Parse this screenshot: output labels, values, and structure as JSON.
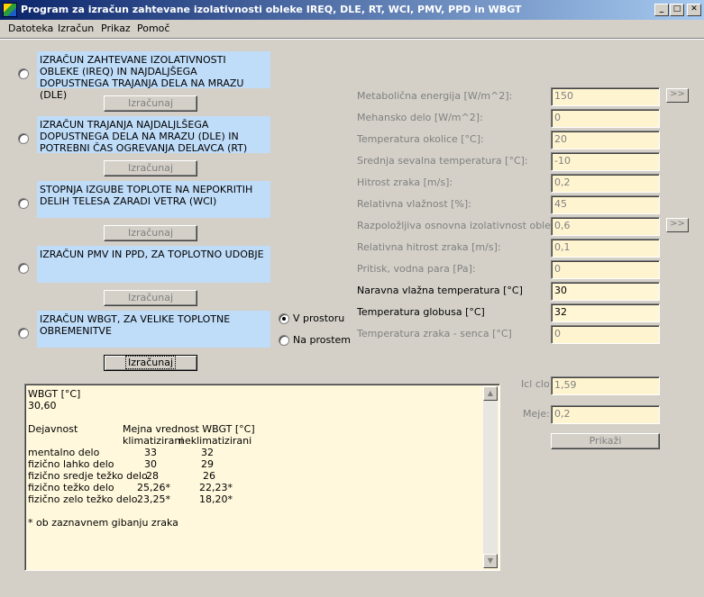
{
  "window": {
    "title": "Program za izračun zahtevane izolativnosti obleke IREQ, DLE, RT, WCI, PMV, PPD in WBGT",
    "minimize_glyph": "_",
    "maximize_glyph": "□",
    "close_glyph": "✕"
  },
  "menu": [
    "Datoteka",
    "Izračun",
    "Prikaz",
    "Pomoč"
  ],
  "options": [
    {
      "text": "IZRAČUN ZAHTEVANE IZOLATIVNOSTI OBLEKE (IREQ) IN NAJDALJŠEGA DOPUSTNEGA TRAJANJA DELA NA MRAZU (DLE)",
      "button": "Izračunaj",
      "selected": false
    },
    {
      "text": "IZRAČUN TRAJANJA NAJDALJLŠEGA DOPUSTNEGA DELA NA MRAZU (DLE) IN POTREBNI ČAS OGREVANJA DELAVCA (RT)",
      "button": "Izračunaj",
      "selected": false
    },
    {
      "text": "STOPNJA IZGUBE TOPLOTE NA NEPOKRITIH DELIH TELESA ZARADI VETRA (WCI)",
      "button": "Izračunaj",
      "selected": false
    },
    {
      "text": "IZRAČUN PMV IN PPD, ZA TOPLOTNO UDOBJE",
      "button": "Izračunaj",
      "selected": false
    },
    {
      "text": "IZRAČUN WBGT, ZA VELIKE TOPLOTNE OBREMENITVE",
      "button": "Izračunaj",
      "selected": false
    }
  ],
  "wbgt_mode": {
    "indoor": "V prostoru",
    "outdoor": "Na prostem",
    "selected": "indoor"
  },
  "params": [
    {
      "label": "Metabolična energija [W/m^2]:",
      "value": "150",
      "active": false
    },
    {
      "label": "Mehansko delo [W/m^2]:",
      "value": "0",
      "active": false
    },
    {
      "label": "Temperatura okolice [°C]:",
      "value": "20",
      "active": false
    },
    {
      "label": "Srednja sevalna temperatura [°C]:",
      "value": "-10",
      "active": false
    },
    {
      "label": "Hitrost zraka [m/s]:",
      "value": "0,2",
      "active": false
    },
    {
      "label": "Relativna vlažnost [%]:",
      "value": "45",
      "active": false
    },
    {
      "label": "Razpoložljiva osnovna izolativnost obleke, Ic",
      "value": "0,6",
      "active": false
    },
    {
      "label": "Relativna hitrost zraka [m/s]:",
      "value": "0,1",
      "active": false
    },
    {
      "label": "Pritisk, vodna para [Pa]:",
      "value": "0",
      "active": false
    },
    {
      "label": "Naravna vlažna temperatura [°C]",
      "value": "30",
      "active": true
    },
    {
      "label": "Temperatura globusa [°C]",
      "value": "32",
      "active": true
    },
    {
      "label": "Temperatura zraka - senca  [°C]",
      "value": "0",
      "active": false
    }
  ],
  "expand_button": ">>",
  "side": {
    "icl_label": "Icl clo:",
    "icl_value": "1,59",
    "meje_label": "Meje:",
    "meje_value": "0,2",
    "show_button": "Prikaži"
  },
  "results": {
    "title": "WBGT [°C]",
    "value": "30,60",
    "col1_header": "Dejavnost",
    "col2_header": "Mejna vrednost WBGT [°C]",
    "sub_a": "klimatizirani",
    "sub_b": "neklimatizirani",
    "rows": [
      {
        "activity": "mentalno delo",
        "a": "33",
        "b": "32"
      },
      {
        "activity": "fizično lahko delo",
        "a": "30",
        "b": "29"
      },
      {
        "activity": "fizično sredje težko delo",
        "a": "28",
        "b": "26"
      },
      {
        "activity": "fizično težko delo",
        "a": "25,26*",
        "b": "22,23*"
      },
      {
        "activity": "fizično zelo težko delo",
        "a": "23,25*",
        "b": "18,20*"
      }
    ],
    "footnote": "* ob zaznavnem gibanju zraka",
    "scroll_up": "▲",
    "scroll_down": "▼"
  }
}
